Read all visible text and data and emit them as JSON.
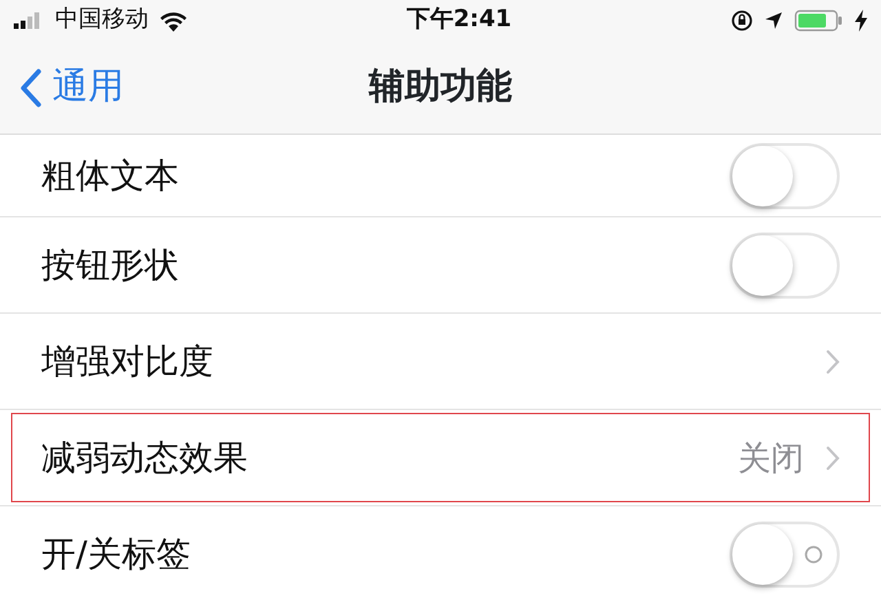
{
  "status_bar": {
    "carrier": "中国移动",
    "time": "下午2:41"
  },
  "nav": {
    "back": "通用",
    "title": "辅助功能"
  },
  "rows": [
    {
      "kind": "switch",
      "label": "粗体文本",
      "on": false
    },
    {
      "kind": "switch",
      "label": "按钮形状",
      "on": false
    },
    {
      "kind": "link",
      "label": "增强对比度",
      "highlighted": false
    },
    {
      "kind": "link",
      "label": "减弱动态效果",
      "value": "关闭",
      "highlighted": true
    },
    {
      "kind": "switch",
      "label": "开/关标签",
      "on": false,
      "onoff_labels": true
    }
  ]
}
